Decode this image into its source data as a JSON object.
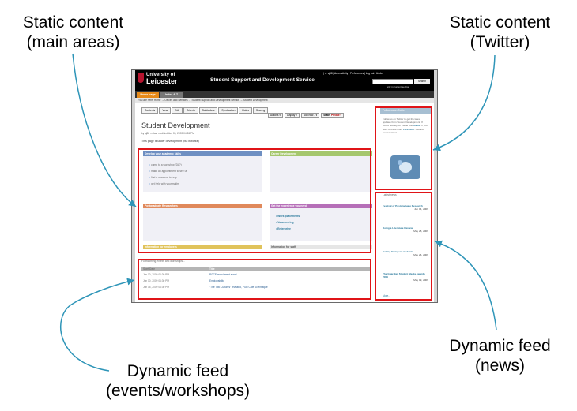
{
  "callouts": {
    "main_l1": "Static content",
    "main_l2": "(main areas)",
    "twitter_l1": "Static content",
    "twitter_l2": "(Twitter)",
    "news_l1": "Dynamic feed",
    "news_l2": "(news)",
    "events_l1": "Dynamic feed",
    "events_l2": "(events/workshops)"
  },
  "site": {
    "logo_line1": "University of",
    "logo_line2": "Leicester",
    "service": "Student Support and Development Service",
    "utility": "| ▲ sj88 | Accessibility | Preferences | Log out | Undo",
    "search_button": "Search",
    "only_section": "only in current section",
    "nav": {
      "home": "Home page",
      "az": "Index A-Z"
    },
    "breadcrumb": "You are here: Home → Offices and Services → Student Support and Development Service → Student Development"
  },
  "tabs": [
    "Contents",
    "View",
    "Edit",
    "Criteria",
    "Subfolders",
    "Syndication",
    "Roles",
    "Sharing"
  ],
  "actions": {
    "actions": "Actions ▾",
    "display": "Display ▾",
    "add": "Add new... ▾",
    "state_label": "State:",
    "state_value": "Private ▾"
  },
  "page": {
    "title": "Student Development",
    "byline": "by sj88 — last modified Jun 05, 2009 04:26 PM",
    "status": "This page is under development (but it works)"
  },
  "panels": {
    "academic": {
      "title": "Develop your academic skills",
      "links": [
        "come to a workshop (DL?)",
        "make an appointment to see us",
        "find a resource to help",
        "get help with your maths"
      ]
    },
    "career": {
      "title": "Career Development"
    },
    "postgrad": {
      "title": "Postgraduate Researchers"
    },
    "experience": {
      "title": "Get the experience you need",
      "links": [
        "Work placements",
        "Volunteering",
        "Enterprise"
      ]
    },
    "employers": {
      "title": "Information for employers"
    },
    "staff": {
      "title": "Information for staff"
    }
  },
  "events": {
    "heading": "Forthcoming events and workshops...",
    "columns": {
      "date": "Start Date",
      "title": "Title"
    },
    "rows": [
      {
        "date": "Jun 10, 2009 06:30 PM",
        "title": "PGCE recruitment event"
      },
      {
        "date": "Jun 10, 2009 06:30 PM",
        "title": "Employability"
      },
      {
        "date": "Jun 15, 2009 06:30 PM",
        "title": "\"The Two Cultures\" revisited, PGR Cafe Scientifique"
      }
    ]
  },
  "twitter": {
    "title": "Follow us on Twitter",
    "text1": "Follow us on Twitter to get the latest updates from Student Development. If you're already on Twitter just",
    "follow": "follow",
    "text2": ". If you want to know more",
    "click": "click here",
    "text3": ". See the conversation!"
  },
  "news": {
    "heading": "Latest news",
    "items": [
      {
        "title": "Festival of Postgraduate Research",
        "date": "Jun 04, 2009"
      },
      {
        "title": "Doing a Literature Review",
        "date": "May 28, 2009"
      },
      {
        "title": "Calling final year students",
        "date": "May 26, 2009"
      },
      {
        "title": "The Guardian Student Media Awards 2009",
        "date": "May 19, 2009"
      }
    ],
    "more": "More..."
  },
  "colors": {
    "highlight": "#e01418",
    "academic": "#6e8fc2",
    "career": "#a5c76d",
    "postgrad": "#e0895b",
    "experience": "#b66fb8",
    "employers": "#e0c35b",
    "staff": "#cfcfcf",
    "home_tab": "#e68a1a"
  }
}
